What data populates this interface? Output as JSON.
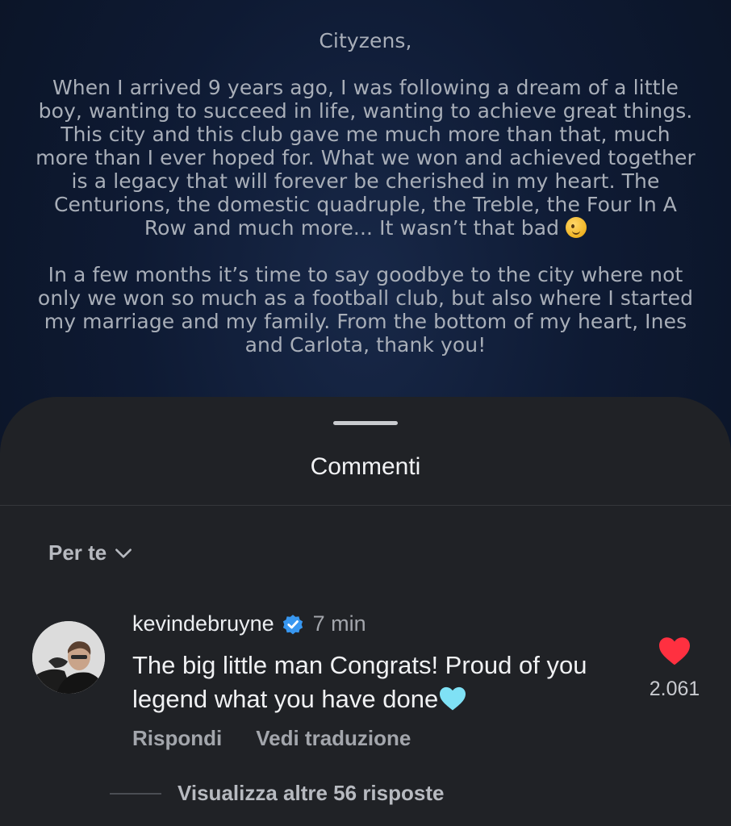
{
  "post": {
    "greeting": "Cityzens,",
    "paragraph1": "When I arrived 9 years ago, I was following a dream of a little boy, wanting to succeed in life, wanting to achieve great things. This city and this club gave me much more than that, much more than I ever hoped for. What we won and achieved together is a legacy that will forever be cherished in my heart. The Centurions, the domestic quadruple, the Treble, the Four In A Row and much more... It wasn’t that bad",
    "paragraph1_emoji": "winking-face-emoji",
    "paragraph2": "In a few months it’s time to say goodbye to the city where not only we won so much as a football club, but also where I started my marriage and my family. From the bottom of my heart, Ines and Carlota, thank you!"
  },
  "sheet": {
    "title": "Commenti",
    "sort_label": "Per te",
    "sort_icon": "chevron-down-icon"
  },
  "comment": {
    "username": "kevindebruyne",
    "verified_icon": "verified-badge-icon",
    "time": "7 min",
    "text": "The big little man Congrats! Proud of you legend what you have done",
    "text_emoji": "light-blue-heart-emoji",
    "reply_label": "Rispondi",
    "translate_label": "Vedi traduzione",
    "like_icon": "heart-icon",
    "like_count": "2.061",
    "more_replies": "Visualizza altre 56 risposte"
  },
  "colors": {
    "sheet_bg": "#202226",
    "like_red": "#ff3040",
    "verified_blue": "#3897f0",
    "heart_blue": "#7fe1f5"
  }
}
